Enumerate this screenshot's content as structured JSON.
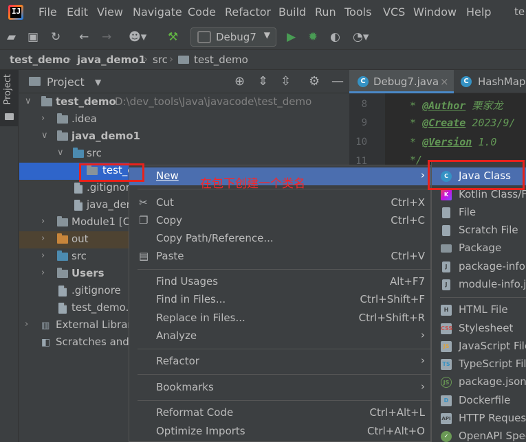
{
  "menubar": {
    "items": [
      "File",
      "Edit",
      "View",
      "Navigate",
      "Code",
      "Refactor",
      "Build",
      "Run",
      "Tools",
      "VCS",
      "Window",
      "Help"
    ],
    "user_fragment": "te"
  },
  "toolbar": {
    "run_config": "Debug7",
    "icons": [
      "folder-open-icon",
      "save-icon",
      "sync-icon",
      "back-icon",
      "forward-icon",
      "user-icon",
      "build-hammer-icon",
      "run-icon",
      "debug-icon",
      "coverage-icon",
      "profile-icon"
    ]
  },
  "breadcrumb": {
    "items": [
      "test_demo",
      "java_demo1",
      "src",
      "test_demo"
    ]
  },
  "sidebar": {
    "tab_label": "Project"
  },
  "project_panel": {
    "title": "Project",
    "tree": [
      {
        "label": "test_demo",
        "path": "D:\\dev_tools\\Java\\javacode\\test_demo"
      },
      {
        "label": ".idea"
      },
      {
        "label": "java_demo1"
      },
      {
        "label": "src"
      },
      {
        "label": "test_c"
      },
      {
        "label": ".gitignor"
      },
      {
        "label": "java_den"
      },
      {
        "label": "Module1 [C"
      },
      {
        "label": "out"
      },
      {
        "label": "src"
      },
      {
        "label": "Users"
      },
      {
        "label": ".gitignore"
      },
      {
        "label": "test_demo."
      },
      {
        "label": "External Librar"
      },
      {
        "label": "Scratches and "
      }
    ]
  },
  "editor": {
    "tabs": [
      {
        "label": "Debug7.java"
      },
      {
        "label": "HashMap"
      }
    ],
    "line_numbers": [
      "8",
      "9",
      "10",
      "11"
    ],
    "lines": [
      {
        "star": "*",
        "tag": "@Author",
        "text": "栗家龙"
      },
      {
        "star": "*",
        "tag": "@Create",
        "text": "2023/9/"
      },
      {
        "star": "*",
        "tag": "@Version",
        "text": "1.0"
      },
      {
        "star": "*/",
        "tag": "",
        "text": ""
      }
    ]
  },
  "context_menu": {
    "items": [
      {
        "label": "New",
        "shortcut": "",
        "submenu": "›"
      },
      {
        "label": "Cut",
        "shortcut": "Ctrl+X",
        "icon": "cut-icon"
      },
      {
        "label": "Copy",
        "shortcut": "Ctrl+C",
        "icon": "copy-icon"
      },
      {
        "label": "Copy Path/Reference...",
        "shortcut": ""
      },
      {
        "label": "Paste",
        "shortcut": "Ctrl+V",
        "icon": "paste-icon"
      },
      {
        "label": "Find Usages",
        "shortcut": "Alt+F7"
      },
      {
        "label": "Find in Files...",
        "shortcut": "Ctrl+Shift+F"
      },
      {
        "label": "Replace in Files...",
        "shortcut": "Ctrl+Shift+R"
      },
      {
        "label": "Analyze",
        "shortcut": "",
        "submenu": "›"
      },
      {
        "label": "Refactor",
        "shortcut": "",
        "submenu": "›"
      },
      {
        "label": "Bookmarks",
        "shortcut": "",
        "submenu": "›"
      },
      {
        "label": "Reformat Code",
        "shortcut": "Ctrl+Alt+L"
      },
      {
        "label": "Optimize Imports",
        "shortcut": "Ctrl+Alt+O"
      }
    ]
  },
  "new_submenu": {
    "items": [
      {
        "label": "Java Class",
        "icon_text": "C"
      },
      {
        "label": "Kotlin Class/F",
        "icon_text": "K"
      },
      {
        "label": "File",
        "icon_text": ""
      },
      {
        "label": "Scratch File",
        "icon_text": ""
      },
      {
        "label": "Package",
        "icon_text": ""
      },
      {
        "label": "package-info.",
        "icon_text": "J"
      },
      {
        "label": "module-info.j",
        "icon_text": "J"
      },
      {
        "label": "HTML File",
        "icon_text": "H"
      },
      {
        "label": "Stylesheet",
        "icon_text": "CSS"
      },
      {
        "label": "JavaScript File",
        "icon_text": "JS"
      },
      {
        "label": "TypeScript Fil",
        "icon_text": "TS"
      },
      {
        "label": "package.json",
        "icon_text": "JS"
      },
      {
        "label": "Dockerfile",
        "icon_text": "D"
      },
      {
        "label": "HTTP Reques",
        "icon_text": "API"
      },
      {
        "label": "OpenAPI Spec",
        "icon_text": "✓"
      }
    ]
  },
  "annotation": {
    "text": "在包下创建一个类名"
  },
  "colors": {
    "highlight": "#4b6eaf",
    "selection": "#2f65ca",
    "annotation_red": "#e8221c"
  }
}
